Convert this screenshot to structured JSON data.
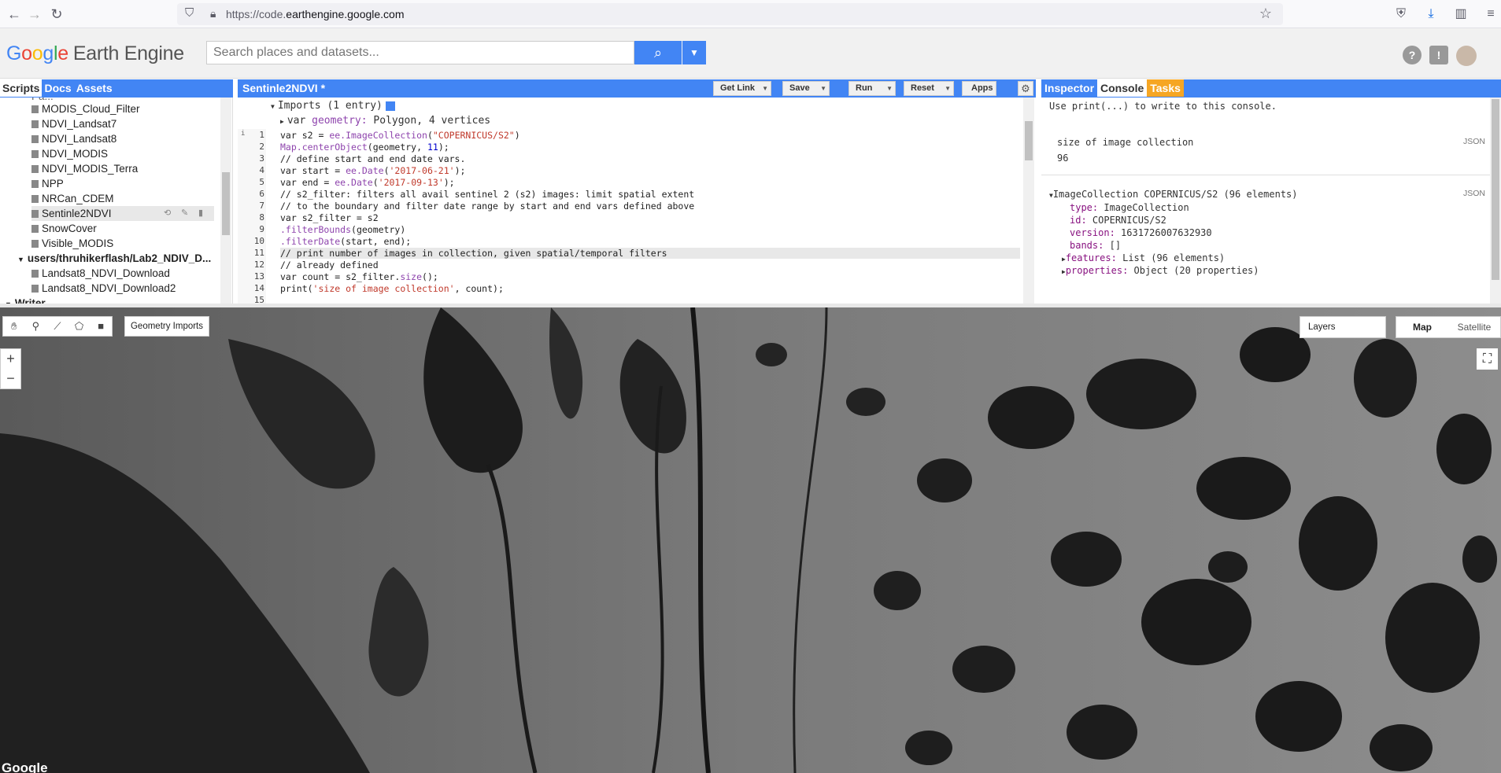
{
  "browser": {
    "url_prefix": "https://code.",
    "url_domain": "earthengine.google.com",
    "back_icon": "arrow-left-icon",
    "forward_icon": "arrow-right-icon",
    "reload_icon": "reload-icon"
  },
  "header": {
    "logo_g": "G",
    "logo_o1": "o",
    "logo_o2": "o",
    "logo_g2": "g",
    "logo_l": "l",
    "logo_e": "e",
    "logo_suffix": "Earth Engine",
    "search_placeholder": "Search places and datasets..."
  },
  "left_panel": {
    "tabs": [
      "Scripts",
      "Docs",
      "Assets"
    ],
    "items": [
      {
        "label": "MODIS_Cloud_Filter"
      },
      {
        "label": "NDVI_Landsat7"
      },
      {
        "label": "NDVI_Landsat8"
      },
      {
        "label": "NDVI_MODIS"
      },
      {
        "label": "NDVI_MODIS_Terra"
      },
      {
        "label": "NPP"
      },
      {
        "label": "NRCan_CDEM"
      },
      {
        "label": "Sentinle2NDVI"
      },
      {
        "label": "SnowCover"
      },
      {
        "label": "Visible_MODIS"
      },
      {
        "label": "users/thruhikerflash/Lab2_NDIV_D..."
      },
      {
        "label": "Landsat8_NDVI_Download"
      },
      {
        "label": "Landsat8_NDVI_Download2"
      },
      {
        "label": "Writer"
      }
    ]
  },
  "editor": {
    "title": "Sentinle2NDVI *",
    "buttons": {
      "get_link": "Get Link",
      "save": "Save",
      "run": "Run",
      "reset": "Reset",
      "apps": "Apps"
    },
    "imports_label": "Imports (1 entry)",
    "import_var": "var",
    "import_name": "geometry:",
    "import_desc": "Polygon, 4 vertices",
    "lines": [
      {
        "n": "1"
      },
      {
        "n": "2"
      },
      {
        "n": "3"
      },
      {
        "n": "4"
      },
      {
        "n": "5"
      },
      {
        "n": "6"
      },
      {
        "n": "7"
      },
      {
        "n": "8"
      },
      {
        "n": "9"
      },
      {
        "n": "10"
      },
      {
        "n": "11"
      },
      {
        "n": "12"
      },
      {
        "n": "13"
      },
      {
        "n": "14"
      },
      {
        "n": "15"
      }
    ],
    "code": {
      "l1a": "var s2 = ",
      "l1b": "ee.ImageCollection",
      "l1c": "(",
      "l1d": "\"COPERNICUS/S2\"",
      "l1e": ")",
      "l2a": "Map.centerObject",
      "l2b": "(geometry, ",
      "l2c": "11",
      "l2d": ");",
      "l3": "// define start and end date vars.",
      "l4a": "var start = ",
      "l4b": "ee.Date",
      "l4c": "(",
      "l4d": "'2017-06-21'",
      "l4e": ");",
      "l5a": "var end = ",
      "l5b": "ee.Date",
      "l5c": "(",
      "l5d": "'2017-09-13'",
      "l5e": ");",
      "l6": "// s2_filter: filters all avail sentinel 2 (s2) images: limit spatial extent",
      "l7": "// to the boundary and filter date range by start and end vars defined above",
      "l8": "var s2_filter = s2",
      "l9a": ".filterBounds",
      "l9b": "(geometry)",
      "l10a": ".filterDate",
      "l10b": "(start, end);",
      "l11": "// print number of images in collection, given spatial/temporal filters",
      "l12": "// already defined",
      "l13a": "var count = s2_filter.",
      "l13b": "size",
      "l13c": "();",
      "l14a": "print(",
      "l14b": "'size of image collection'",
      "l14c": ", count);"
    }
  },
  "right_panel": {
    "tabs": [
      "Inspector",
      "Console",
      "Tasks"
    ],
    "hint": "Use print(...) to write to this console.",
    "json_label": "JSON",
    "size_label": "size of image collection",
    "size_value": "96",
    "collection_header": "ImageCollection COPERNICUS/S2 (96 elements)",
    "props": {
      "type_k": "type:",
      "type_v": "ImageCollection",
      "id_k": "id:",
      "id_v": "COPERNICUS/S2",
      "version_k": "version:",
      "version_v": "1631726007632930",
      "bands_k": "bands:",
      "bands_v": "[]",
      "features_k": "features:",
      "features_v": "List (96 elements)",
      "properties_k": "properties:",
      "properties_v": "Object (20 properties)"
    }
  },
  "map": {
    "geometry_imports": "Geometry Imports",
    "layers": "Layers",
    "map_label": "Map",
    "satellite_label": "Satellite",
    "zoom_in": "+",
    "zoom_out": "−",
    "watermark": "Google"
  }
}
